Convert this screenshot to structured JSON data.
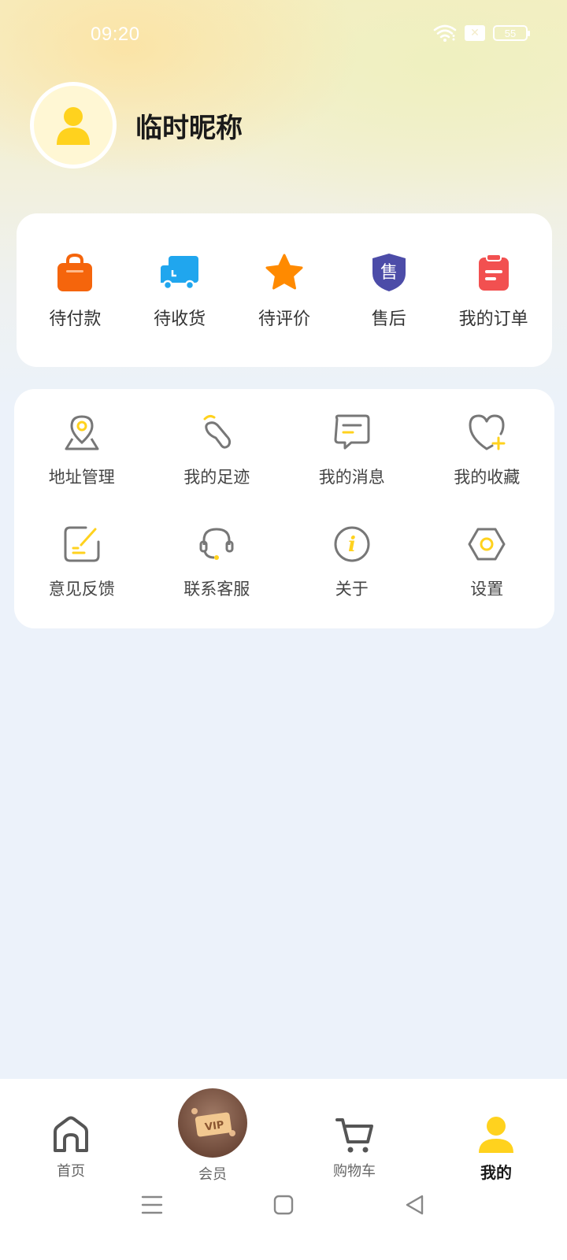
{
  "status": {
    "time": "09:20",
    "battery": "55"
  },
  "profile": {
    "nickname": "临时昵称"
  },
  "orders": [
    {
      "label": "待付款",
      "icon": "shopping-bag-icon"
    },
    {
      "label": "待收货",
      "icon": "truck-icon"
    },
    {
      "label": "待评价",
      "icon": "star-icon"
    },
    {
      "label": "售后",
      "icon": "shield-icon",
      "glyph": "售"
    },
    {
      "label": "我的订单",
      "icon": "clipboard-icon"
    }
  ],
  "menu": [
    {
      "label": "地址管理",
      "icon": "location-pin-icon"
    },
    {
      "label": "我的足迹",
      "icon": "footprint-icon"
    },
    {
      "label": "我的消息",
      "icon": "message-icon"
    },
    {
      "label": "我的收藏",
      "icon": "heart-plus-icon"
    },
    {
      "label": "意见反馈",
      "icon": "edit-note-icon"
    },
    {
      "label": "联系客服",
      "icon": "headset-icon"
    },
    {
      "label": "关于",
      "icon": "info-icon",
      "glyph": "i"
    },
    {
      "label": "设置",
      "icon": "hexagon-settings-icon"
    }
  ],
  "tabbar": {
    "home": "首页",
    "vip": "会员",
    "vip_badge": "VIP",
    "cart": "购物车",
    "mine": "我的"
  },
  "colors": {
    "accent": "#FFD21E",
    "orange": "#F5650C",
    "blue": "#20A6EE",
    "star": "#FF8A00",
    "shield": "#4C4CA8",
    "red": "#F25050"
  }
}
